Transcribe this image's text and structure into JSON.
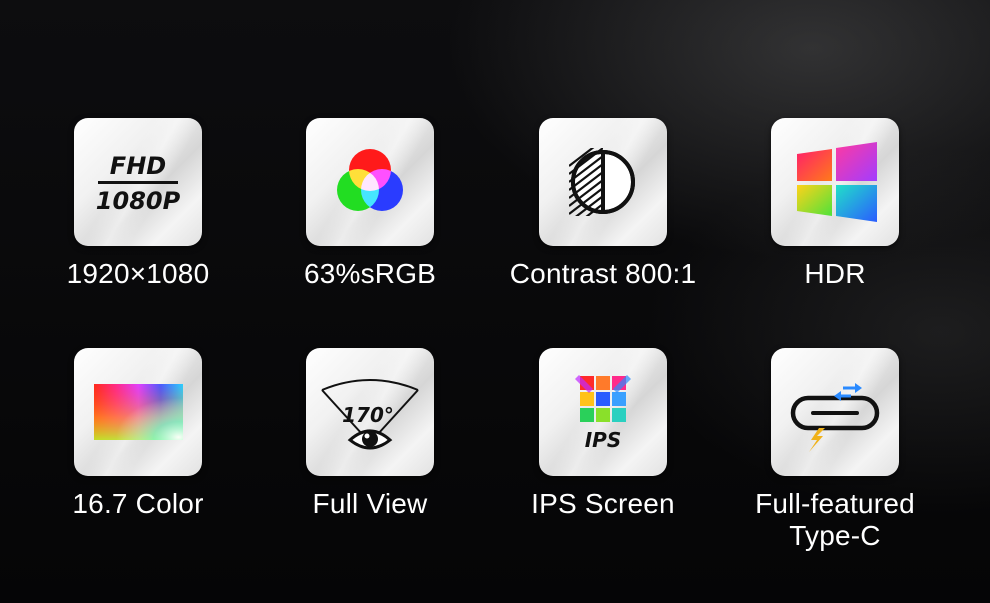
{
  "features": [
    {
      "id": "resolution",
      "label": "1920×1080",
      "icon": "fhd-1080p-icon",
      "icon_text": [
        "FHD",
        "1080P"
      ]
    },
    {
      "id": "color-gamut",
      "label": "63%sRGB",
      "icon": "rgb-circles-icon"
    },
    {
      "id": "contrast",
      "label": "Contrast 800:1",
      "icon": "contrast-circle-icon"
    },
    {
      "id": "hdr",
      "label": "HDR",
      "icon": "hdr-window-icon"
    },
    {
      "id": "colors",
      "label": "16.7 Color",
      "icon": "color-spectrum-icon"
    },
    {
      "id": "viewing-angle",
      "label": "Full View",
      "icon": "eye-view-angle-icon",
      "icon_text": [
        "170°"
      ]
    },
    {
      "id": "panel",
      "label": "IPS Screen",
      "icon": "ips-panel-icon",
      "icon_text": [
        "IPS"
      ]
    },
    {
      "id": "port",
      "label": "Full-featured\nType-C",
      "icon": "type-c-port-icon"
    }
  ]
}
